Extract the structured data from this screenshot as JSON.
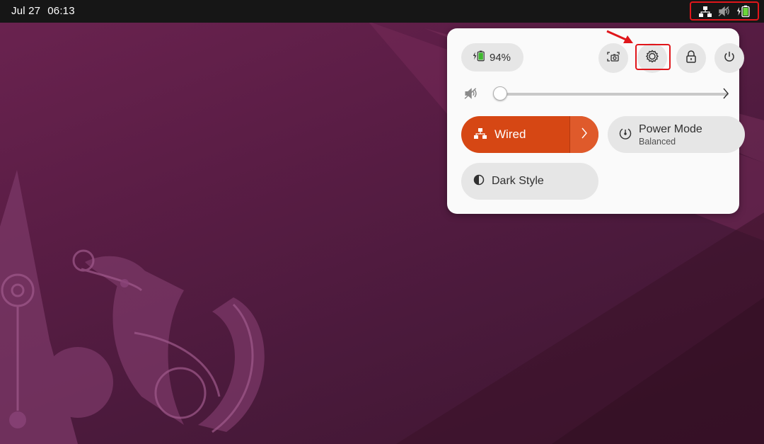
{
  "topbar": {
    "date": "Jul 27",
    "time": "06:13",
    "tray_icons": [
      "network-wired-icon",
      "volume-muted-icon",
      "battery-charging-icon"
    ]
  },
  "quick_settings": {
    "battery": {
      "percent_label": "94%",
      "icon": "battery-charging-icon"
    },
    "buttons": [
      {
        "name": "screenshot",
        "icon": "screenshot-icon"
      },
      {
        "name": "settings",
        "icon": "gear-icon",
        "highlighted": true
      },
      {
        "name": "lock",
        "icon": "lock-icon"
      },
      {
        "name": "power",
        "icon": "power-icon"
      }
    ],
    "volume": {
      "level": 0.0,
      "muted": true
    },
    "wired": {
      "label": "Wired",
      "active": true
    },
    "power_mode": {
      "label": "Power Mode",
      "value": "Balanced"
    },
    "dark_style": {
      "label": "Dark Style",
      "active": false
    }
  },
  "colors": {
    "accent": "#d64714",
    "topbar": "#161616",
    "panel": "#fafafa",
    "annotation": "#e0161b"
  }
}
